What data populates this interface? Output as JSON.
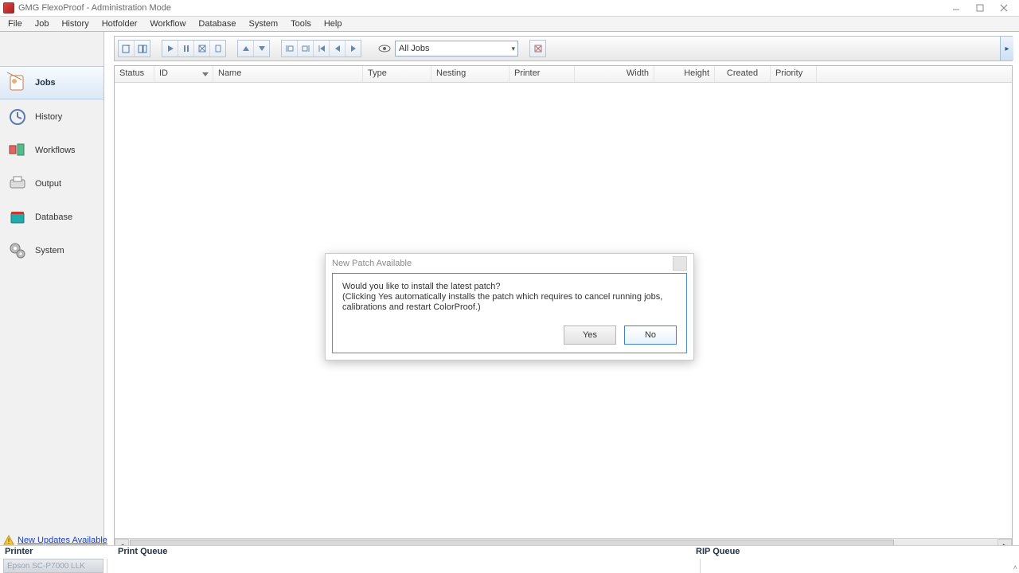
{
  "window": {
    "title": "GMG FlexoProof - Administration Mode"
  },
  "menu": {
    "items": [
      "File",
      "Job",
      "History",
      "Hotfolder",
      "Workflow",
      "Database",
      "System",
      "Tools",
      "Help"
    ]
  },
  "toolbar": {
    "job_filter": "All Jobs"
  },
  "sidebar": {
    "items": [
      {
        "label": "Jobs",
        "icon": "jobs"
      },
      {
        "label": "History",
        "icon": "history"
      },
      {
        "label": "Workflows",
        "icon": "workflows"
      },
      {
        "label": "Output",
        "icon": "output"
      },
      {
        "label": "Database",
        "icon": "database"
      },
      {
        "label": "System",
        "icon": "system"
      }
    ],
    "active_index": 0
  },
  "columns": [
    {
      "label": "Status",
      "width": 50
    },
    {
      "label": "ID",
      "width": 74,
      "sort": true
    },
    {
      "label": "Name",
      "width": 188
    },
    {
      "label": "Type",
      "width": 86
    },
    {
      "label": "Nesting",
      "width": 98
    },
    {
      "label": "Printer",
      "width": 82
    },
    {
      "label": "Width",
      "width": 100
    },
    {
      "label": "Height",
      "width": 76
    },
    {
      "label": "Created",
      "width": 70
    },
    {
      "label": "Priority",
      "width": 58
    }
  ],
  "updates": {
    "link_text": "New Updates Available"
  },
  "status": {
    "printer_label": "Printer",
    "print_queue_label": "Print Queue",
    "rip_queue_label": "RIP Queue",
    "printer_value": "Epson SC-P7000 LLK"
  },
  "dialog": {
    "title": "New Patch Available",
    "line1": "Would you like to install the latest patch?",
    "line2": "(Clicking Yes automatically installs the patch which requires to cancel running jobs, calibrations and restart ColorProof.)",
    "yes": "Yes",
    "no": "No"
  }
}
